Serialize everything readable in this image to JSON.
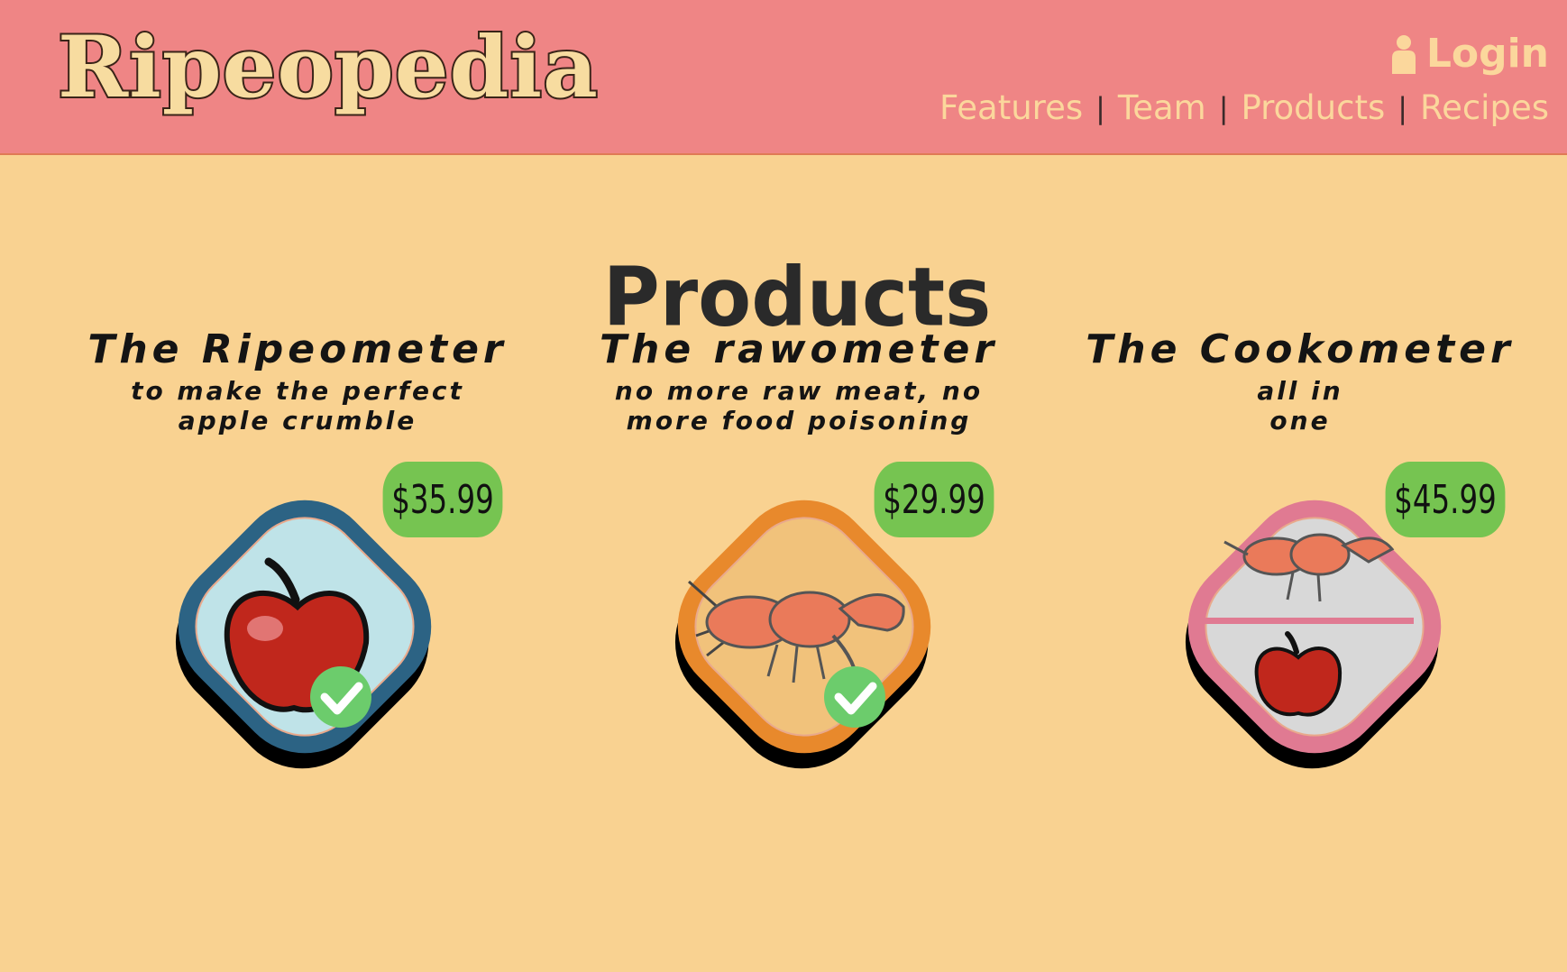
{
  "header": {
    "logo_text": "Ripeopedia",
    "login_label": "Login",
    "nav": [
      "Features",
      "Team",
      "Products",
      "Recipes"
    ]
  },
  "main": {
    "title": "Products",
    "products": [
      {
        "name": "The Ripeometer",
        "tagline": "to make the perfect apple crumble",
        "price": "$35.99",
        "icon": "apple-icon",
        "verified": true,
        "frame_color": "#2c6384",
        "fill_color": "#bfe3e8"
      },
      {
        "name": "The rawometer",
        "tagline": "no more raw meat, no more food poisoning",
        "price": "$29.99",
        "icon": "crayfish-icon",
        "verified": true,
        "frame_color": "#e8892c",
        "fill_color": "#f1c27b"
      },
      {
        "name": "The Cookometer",
        "tagline": "all in one",
        "price": "$45.99",
        "icon": "crayfish-and-apple-icon",
        "verified": false,
        "frame_color": "#e07a92",
        "fill_color": "#d8d8d8"
      }
    ]
  },
  "colors": {
    "header_bg": "#ef8585",
    "page_bg": "#f9d291",
    "price_badge": "#76c451",
    "nav_text": "#fbd79c"
  }
}
